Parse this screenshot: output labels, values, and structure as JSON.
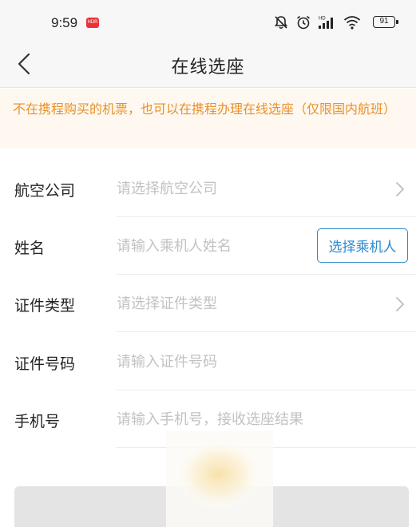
{
  "status_bar": {
    "time": "9:59",
    "hdr_badge": "HDR",
    "battery": "91",
    "icons": [
      "mute-icon",
      "alarm-icon",
      "hd-signal-icon",
      "wifi-icon",
      "battery-icon"
    ]
  },
  "nav": {
    "title": "在线选座",
    "back_icon": "chevron-left-icon"
  },
  "notice": {
    "text": "不在携程购买的机票，也可以在携程办理在线选座（仅限国内航班）",
    "color": "#e8912a",
    "background": "#fff8f0"
  },
  "form": {
    "airline": {
      "label": "航空公司",
      "placeholder": "请选择航空公司"
    },
    "name": {
      "label": "姓名",
      "placeholder": "请输入乘机人姓名",
      "button_label": "选择乘机人"
    },
    "id_type": {
      "label": "证件类型",
      "placeholder": "请选择证件类型"
    },
    "id_number": {
      "label": "证件号码",
      "placeholder": "请输入证件号码"
    },
    "phone": {
      "label": "手机号",
      "placeholder": "请输入手机号，接收选座结果"
    }
  },
  "colors": {
    "accent_blue": "#2a8bd1",
    "placeholder_gray": "#c2c2c2",
    "disabled_button": "#e4e4e4"
  }
}
